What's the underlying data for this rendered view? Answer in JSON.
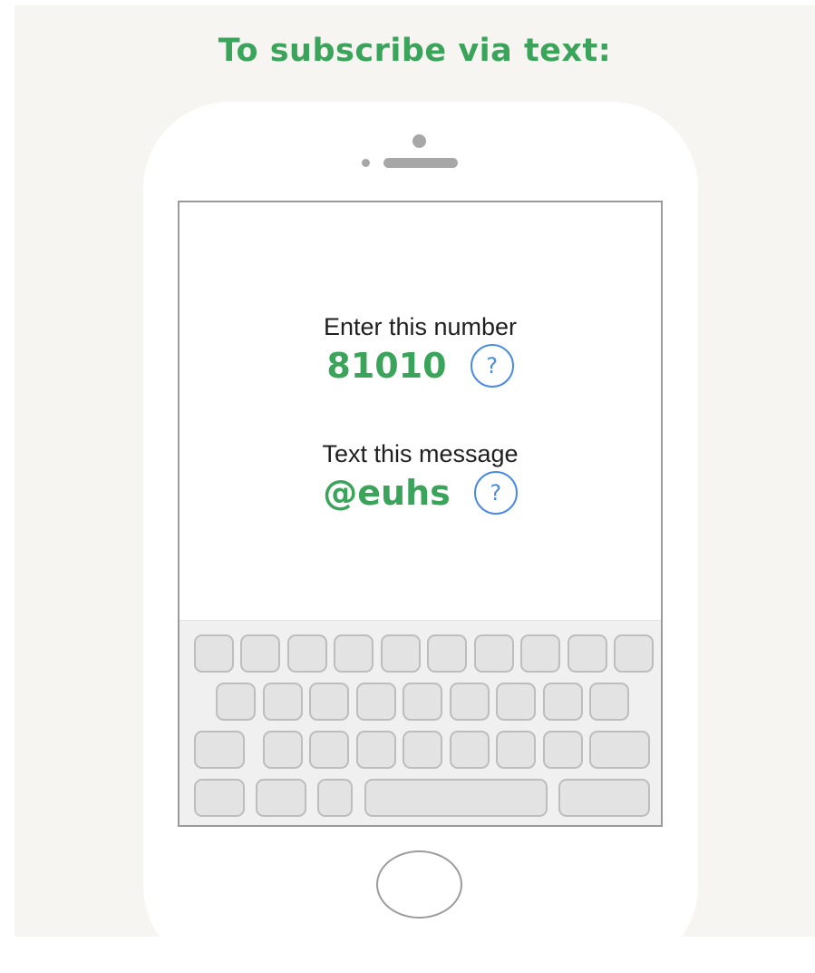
{
  "header": {
    "title": "To subscribe via text:"
  },
  "screen": {
    "number_label": "Enter this number",
    "number_value": "81010",
    "message_label": "Text this message",
    "message_value": "@euhs",
    "help_glyph": "?"
  },
  "icons": {
    "help": "help-circle-icon",
    "home": "home-button-icon",
    "camera": "front-camera-icon",
    "speaker": "earpiece-speaker-icon"
  },
  "colors": {
    "accent_green": "#3aa45b",
    "help_blue": "#4a8be3",
    "background": "#f6f5f1"
  }
}
